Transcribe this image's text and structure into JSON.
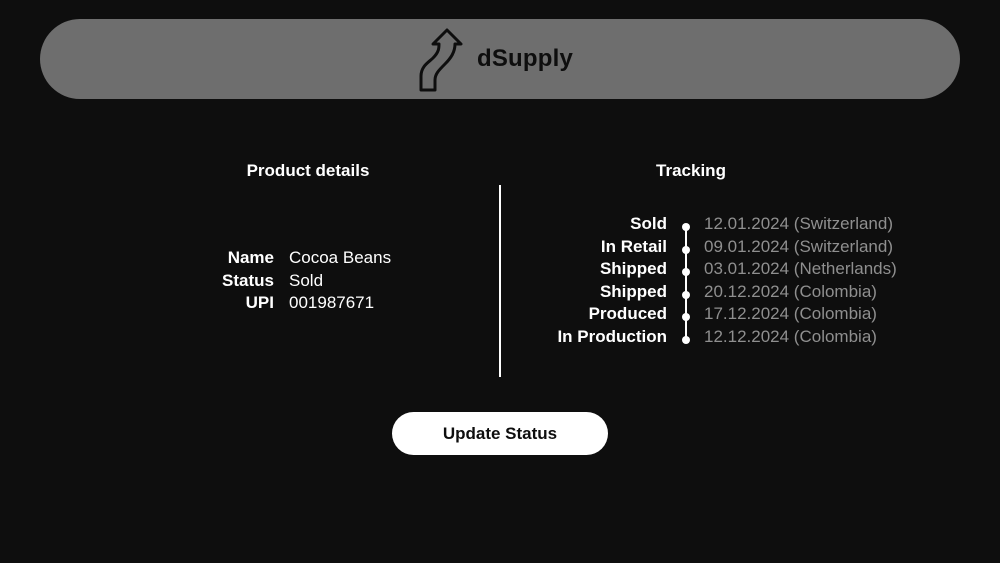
{
  "header": {
    "brand_name": "dSupply",
    "logo_icon": "upward-path-arrow-icon"
  },
  "product_details": {
    "title": "Product details",
    "fields": [
      {
        "label": "Name",
        "value": "Cocoa Beans"
      },
      {
        "label": "Status",
        "value": "Sold"
      },
      {
        "label": "UPI",
        "value": "001987671"
      }
    ]
  },
  "tracking": {
    "title": "Tracking",
    "events": [
      {
        "status": "Sold",
        "info": "12.01.2024 (Switzerland)"
      },
      {
        "status": "In Retail",
        "info": "09.01.2024 (Switzerland)"
      },
      {
        "status": "Shipped",
        "info": "03.01.2024 (Netherlands)"
      },
      {
        "status": "Shipped",
        "info": "20.12.2024 (Colombia)"
      },
      {
        "status": "Produced",
        "info": "17.12.2024 (Colombia)"
      },
      {
        "status": "In Production",
        "info": "12.12.2024 (Colombia)"
      }
    ]
  },
  "actions": {
    "update_status_label": "Update Status"
  },
  "colors": {
    "background": "#0e0e0e",
    "header_bg": "#6e6e6e",
    "text": "#ffffff",
    "muted_text": "#8f8f8f"
  }
}
